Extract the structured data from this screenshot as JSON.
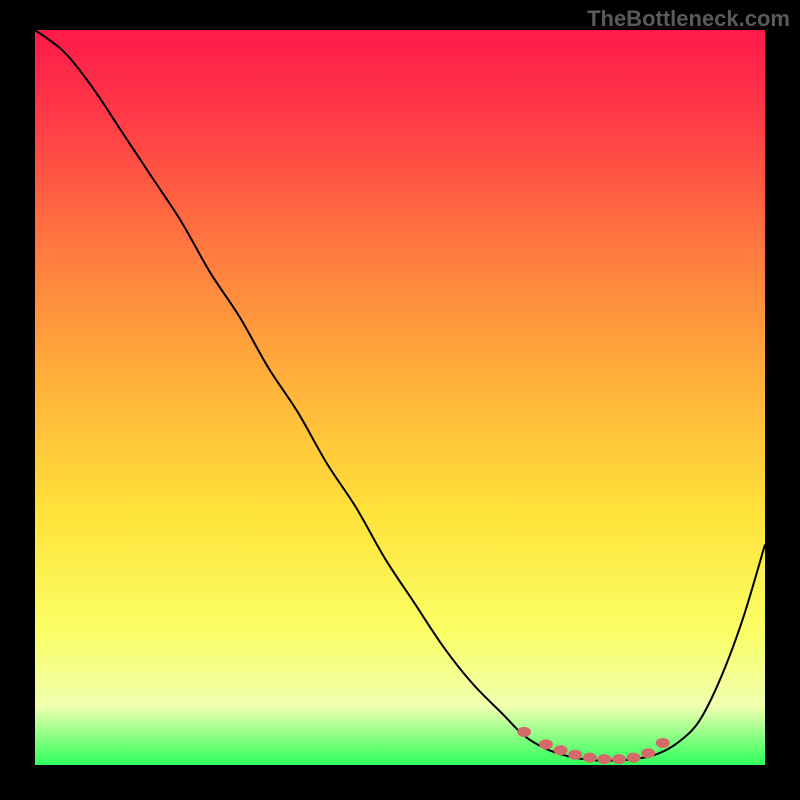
{
  "watermark": "TheBottleneck.com",
  "colors": {
    "gradient_top": "#ff1a4a",
    "gradient_bottom": "#2dff5a",
    "curve": "#000000",
    "dots": "#d46a6a",
    "background": "#000000"
  },
  "chart_data": {
    "type": "line",
    "title": "",
    "xlabel": "",
    "ylabel": "",
    "xlim": [
      0,
      100
    ],
    "ylim": [
      0,
      100
    ],
    "series": [
      {
        "name": "bottleneck-curve",
        "x": [
          0,
          4,
          8,
          12,
          16,
          20,
          24,
          28,
          32,
          36,
          40,
          44,
          48,
          52,
          56,
          60,
          64,
          67,
          70,
          73,
          76,
          79,
          82,
          85,
          88,
          91,
          94,
          97,
          100
        ],
        "values": [
          100,
          97,
          92,
          86,
          80,
          74,
          67,
          61,
          54,
          48,
          41,
          35,
          28,
          22,
          16,
          11,
          7,
          4,
          2.2,
          1.2,
          0.7,
          0.6,
          0.8,
          1.4,
          3,
          6,
          12,
          20,
          30
        ]
      }
    ],
    "optimal_region": {
      "x": [
        67,
        70,
        72,
        74,
        76,
        78,
        80,
        82,
        84,
        86
      ],
      "values": [
        4.5,
        2.8,
        2.0,
        1.4,
        1.0,
        0.8,
        0.8,
        1.0,
        1.6,
        3.0
      ]
    }
  }
}
